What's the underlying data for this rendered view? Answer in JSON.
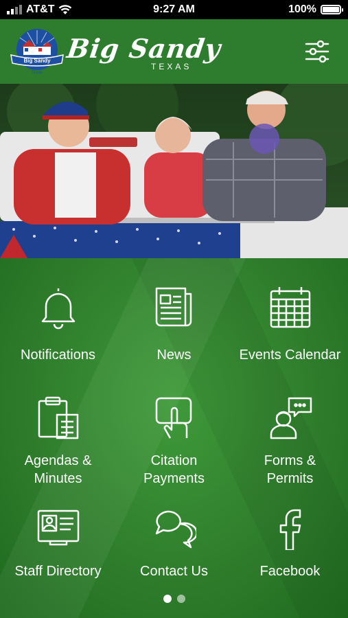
{
  "status_bar": {
    "carrier": "AT&T",
    "time": "9:27 AM",
    "battery": "100%"
  },
  "header": {
    "brand_name": "Big Sandy",
    "brand_sub": "TEXAS",
    "logo_text": "Big Sandy",
    "logo_sub": "Texas"
  },
  "tiles": [
    {
      "label": "Notifications",
      "icon": "bell-icon"
    },
    {
      "label": "News",
      "icon": "newspaper-icon"
    },
    {
      "label": "Events Calendar",
      "icon": "calendar-icon"
    },
    {
      "label": "Agendas &\nMinutes",
      "icon": "clipboard-icon"
    },
    {
      "label": "Citation\nPayments",
      "icon": "touch-payment-icon"
    },
    {
      "label": "Forms &\nPermits",
      "icon": "person-chat-icon"
    },
    {
      "label": "Staff Directory",
      "icon": "id-card-icon"
    },
    {
      "label": "Contact Us",
      "icon": "chat-bubbles-icon"
    },
    {
      "label": "Facebook",
      "icon": "facebook-icon"
    }
  ],
  "pager": {
    "pages": 2,
    "current": 1
  }
}
